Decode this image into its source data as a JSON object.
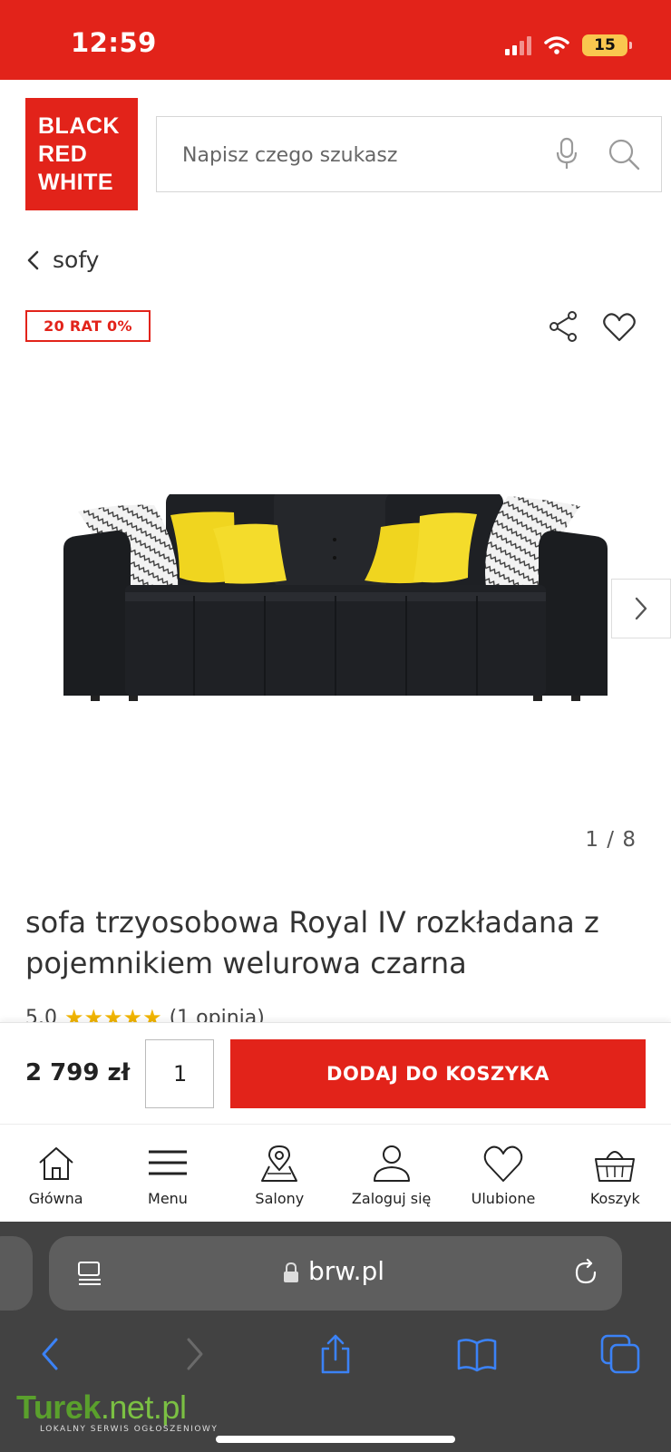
{
  "status_bar": {
    "time": "12:59",
    "battery": "15"
  },
  "header": {
    "logo_lines": [
      "BLACK",
      "RED",
      "WHITE"
    ],
    "search_placeholder": "Napisz czego szukasz"
  },
  "breadcrumb": {
    "label": "sofy"
  },
  "product": {
    "badge": "20 RAT 0%",
    "gallery_counter": "1 / 8",
    "title": "sofa trzyosobowa Royal IV rozkładana z pojemnikiem welurowa czarna",
    "rating": "5.0",
    "rating_stars": 5,
    "reviews": "(1 opinia)"
  },
  "cart_bar": {
    "price": "2 799 zł",
    "quantity": "1",
    "add_to_cart_label": "DODAJ DO KOSZYKA"
  },
  "bottom_nav": {
    "items": [
      {
        "label": "Główna",
        "icon": "home-icon"
      },
      {
        "label": "Menu",
        "icon": "menu-icon"
      },
      {
        "label": "Salony",
        "icon": "map-pin-icon"
      },
      {
        "label": "Zaloguj się",
        "icon": "user-icon"
      },
      {
        "label": "Ulubione",
        "icon": "heart-icon"
      },
      {
        "label": "Koszyk",
        "icon": "basket-icon"
      }
    ]
  },
  "browser": {
    "url": "brw.pl",
    "watermark_main_1": "Turek",
    "watermark_main_2": ".net.pl",
    "watermark_sub": "LOKALNY SERWIS OGŁOSZENIOWY"
  },
  "colors": {
    "brand_red": "#e2231a",
    "browser_gray": "#424242",
    "safari_blue": "#3b82f6"
  }
}
